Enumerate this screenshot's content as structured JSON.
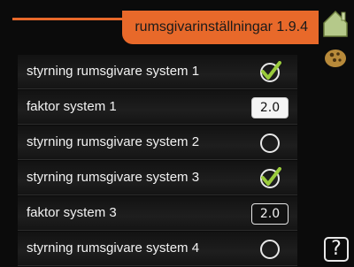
{
  "header": {
    "title": "rumsgivarinställningar 1.9.4"
  },
  "icons": {
    "top": "house-icon",
    "middle": "cookie-icon",
    "help": "help-icon"
  },
  "help_label": "?",
  "rows": [
    {
      "label": "styrning rumsgivare system 1",
      "control": "check",
      "checked": true
    },
    {
      "label": "faktor system 1",
      "control": "value",
      "value": "2.0",
      "selected": true
    },
    {
      "label": "styrning rumsgivare system 2",
      "control": "check",
      "checked": false
    },
    {
      "label": "styrning rumsgivare system 3",
      "control": "check",
      "checked": true
    },
    {
      "label": "faktor system 3",
      "control": "value",
      "value": "2.0",
      "selected": false
    },
    {
      "label": "styrning rumsgivare system 4",
      "control": "check",
      "checked": false
    }
  ],
  "colors": {
    "accent": "#e8692a",
    "check": "#9acb3c",
    "background": "#0b0b0b"
  }
}
